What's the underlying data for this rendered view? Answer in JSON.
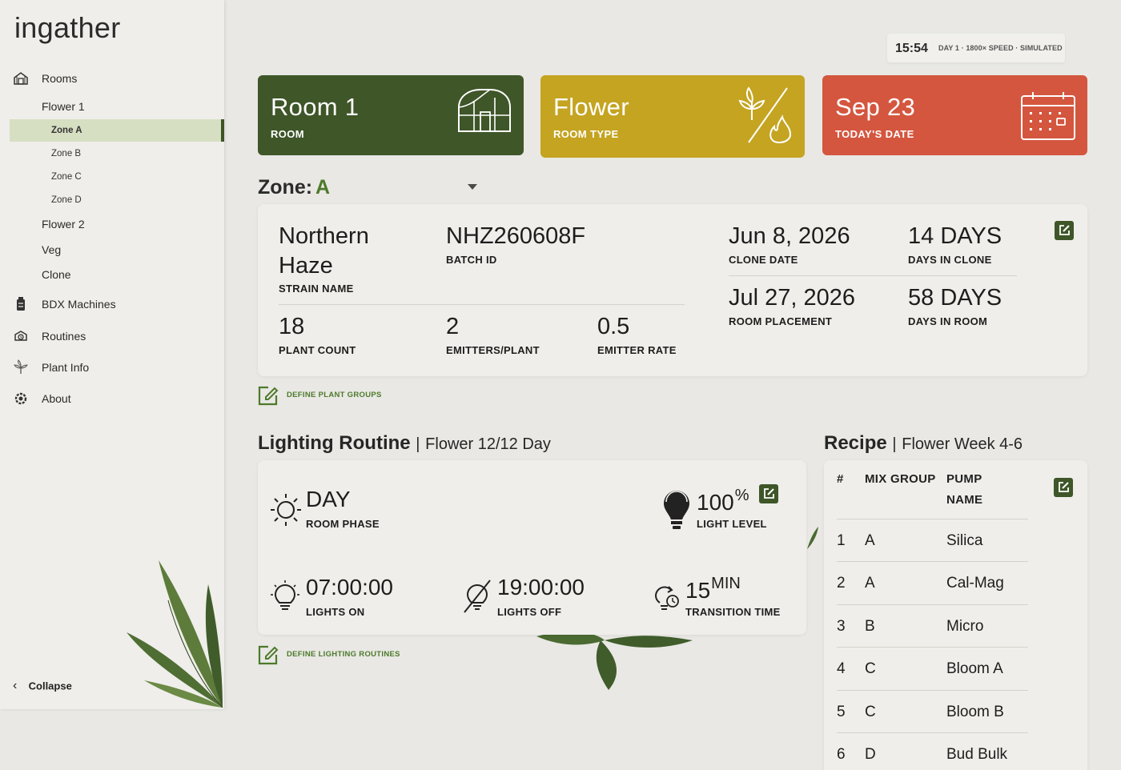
{
  "app": {
    "logo": "ingather"
  },
  "sidebar": {
    "rooms_label": "Rooms",
    "room_flower1": "Flower 1",
    "zones": [
      "Zone A",
      "Zone B",
      "Zone C",
      "Zone D"
    ],
    "active_zone": "Zone A",
    "room_flower2": "Flower 2",
    "room_veg": "Veg",
    "room_clone": "Clone",
    "bdx_machines": "BDX Machines",
    "routines": "Routines",
    "plant_info": "Plant Info",
    "about": "About",
    "collapse": "Collapse"
  },
  "clock": {
    "time": "15:54",
    "info": "DAY 1 · 1800× SPEED · SIMULATED"
  },
  "cards": {
    "room": {
      "value": "Room 1",
      "label": "ROOM",
      "color": "#3e5628"
    },
    "type": {
      "value": "Flower",
      "label": "ROOM TYPE",
      "color": "#c4a421"
    },
    "date": {
      "value": "Sep 23",
      "label": "TODAY'S DATE",
      "color": "#d4563f"
    }
  },
  "zone": {
    "label": "Zone:",
    "value": "A"
  },
  "batch": {
    "strain_line1": "Northern",
    "strain_line2": "Haze",
    "strain_label": "STRAIN NAME",
    "batch_id": "NHZ260608F",
    "batch_id_label": "BATCH ID",
    "plant_count": "18",
    "plant_count_label": "PLANT COUNT",
    "emitters": "2",
    "emitters_label": "EMITTERS/PLANT",
    "emitter_rate": "0.5",
    "emitter_rate_label": "EMITTER RATE",
    "clone_date": "Jun 8, 2026",
    "clone_date_label": "CLONE DATE",
    "days_clone": "14 DAYS",
    "days_clone_label": "DAYS IN CLONE",
    "room_placement": "Jul 27, 2026",
    "room_placement_label": "ROOM PLACEMENT",
    "days_room": "58 DAYS",
    "days_room_label": "DAYS IN ROOM"
  },
  "define_plant_groups": "DEFINE PLANT GROUPS",
  "lighting": {
    "title": "Lighting Routine",
    "separator": "|",
    "subtitle": "Flower 12/12 Day",
    "phase": "DAY",
    "phase_label": "ROOM PHASE",
    "level": "100",
    "level_unit": "%",
    "level_label": "LIGHT LEVEL",
    "on": "07:00:00",
    "on_label": "LIGHTS ON",
    "off": "19:00:00",
    "off_label": "LIGHTS OFF",
    "transition": "15",
    "transition_unit": "MIN",
    "transition_label": "TRANSITION TIME"
  },
  "define_lighting_routines": "DEFINE LIGHTING ROUTINES",
  "recipe": {
    "title": "Recipe",
    "separator": "|",
    "subtitle": "Flower Week 4-6",
    "col_num": "#",
    "col_group": "MIX GROUP",
    "col_pump_line1": "PUMP",
    "col_pump_line2": "NAME",
    "rows": [
      {
        "num": "1",
        "group": "A",
        "pump": "Silica"
      },
      {
        "num": "2",
        "group": "A",
        "pump": "Cal-Mag"
      },
      {
        "num": "3",
        "group": "B",
        "pump": "Micro"
      },
      {
        "num": "4",
        "group": "C",
        "pump": "Bloom A"
      },
      {
        "num": "5",
        "group": "C",
        "pump": "Bloom B"
      },
      {
        "num": "6",
        "group": "D",
        "pump": "Bud Bulk"
      }
    ]
  },
  "colors": {
    "accent_green": "#3e5628",
    "zone_green": "#4d7a2b",
    "active_bg": "#d7dfc3"
  }
}
